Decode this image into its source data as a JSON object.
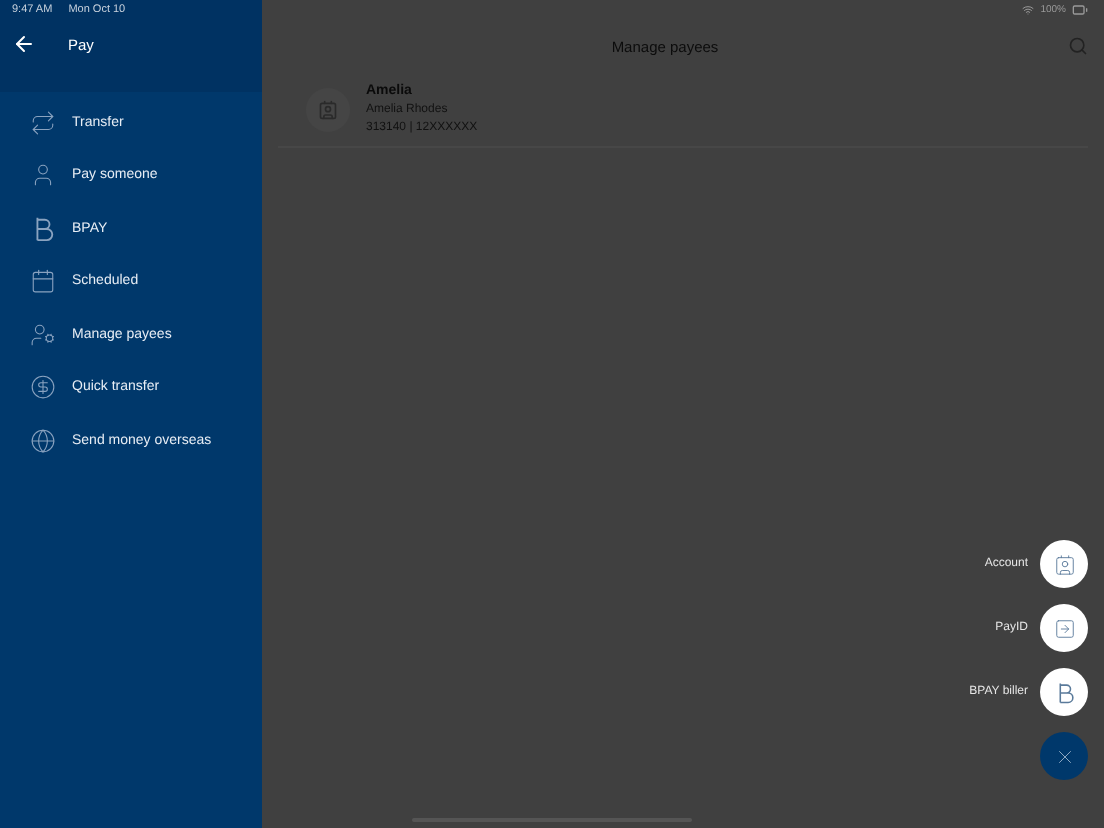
{
  "status_bar": {
    "time": "9:47 AM",
    "date": "Mon Oct 10",
    "battery": "100%"
  },
  "sidebar": {
    "title": "Pay",
    "items": [
      {
        "label": "Transfer"
      },
      {
        "label": "Pay someone"
      },
      {
        "label": "BPAY"
      },
      {
        "label": "Scheduled"
      },
      {
        "label": "Manage payees"
      },
      {
        "label": "Quick transfer"
      },
      {
        "label": "Send money overseas"
      }
    ]
  },
  "main": {
    "title": "Manage payees",
    "payees": [
      {
        "name": "Amelia",
        "full_name": "Amelia Rhodes",
        "account": "313140 | 12XXXXXX"
      }
    ]
  },
  "fab": {
    "actions": [
      {
        "label": "Account"
      },
      {
        "label": "PayID"
      },
      {
        "label": "BPAY biller"
      }
    ]
  }
}
